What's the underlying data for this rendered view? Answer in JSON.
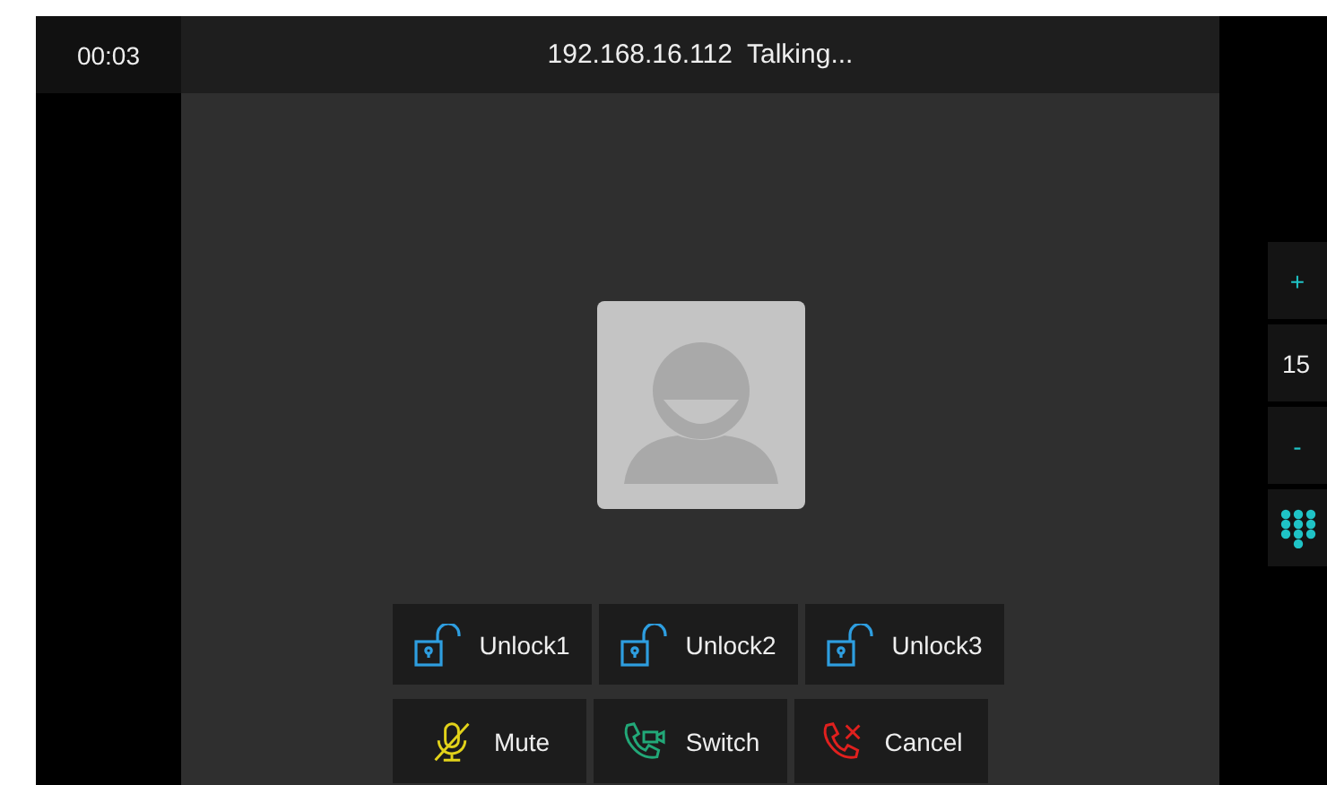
{
  "timer": "00:03",
  "title": "192.168.16.112  Talking...",
  "side_controls": [
    {
      "kind": "plus",
      "label": "+"
    },
    {
      "kind": "value",
      "label": "15"
    },
    {
      "kind": "minus",
      "label": "-"
    },
    {
      "kind": "keypad"
    }
  ],
  "action_rows": [
    [
      {
        "kind": "unlock",
        "label": "Unlock1"
      },
      {
        "kind": "unlock",
        "label": "Unlock2"
      },
      {
        "kind": "unlock",
        "label": "Unlock3"
      }
    ],
    [
      {
        "kind": "mute",
        "label": "Mute"
      },
      {
        "kind": "switch",
        "label": "Switch"
      },
      {
        "kind": "cancel",
        "label": "Cancel"
      }
    ]
  ]
}
